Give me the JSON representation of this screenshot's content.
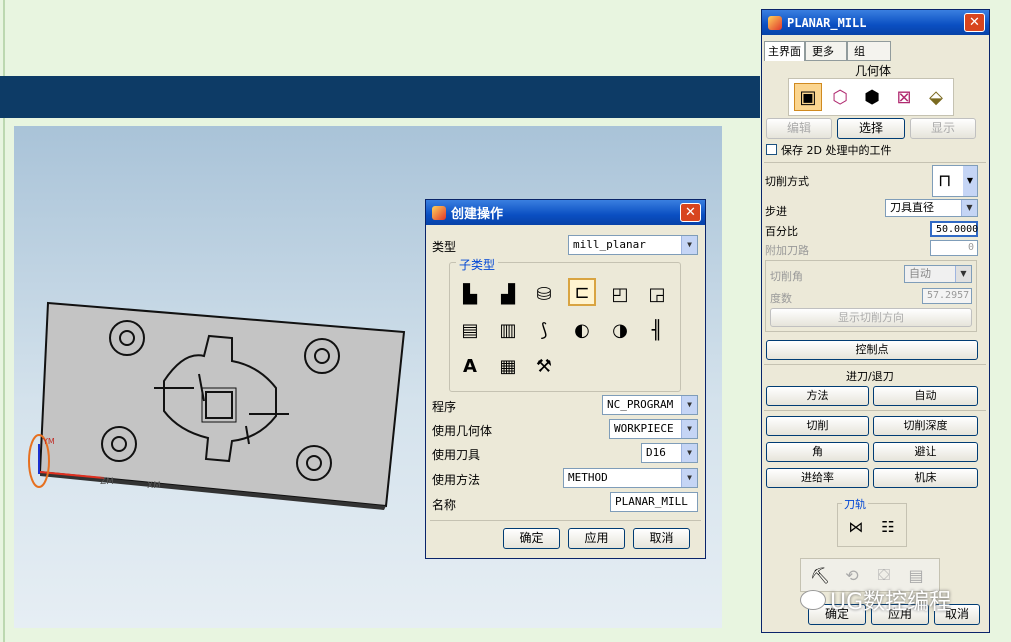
{
  "viewport": {
    "label_xm": "XM",
    "label_ym": "YM"
  },
  "create_op": {
    "title": "创建操作",
    "type_label": "类型",
    "type_value": "mill_planar",
    "subtype_label": "子类型",
    "program_label": "程序",
    "program_value": "NC_PROGRAM",
    "geometry_label": "使用几何体",
    "geometry_value": "WORKPIECE",
    "tool_label": "使用刀具",
    "tool_value": "D16",
    "method_label": "使用方法",
    "method_value": "METHOD",
    "name_label": "名称",
    "name_value": "PLANAR_MILL",
    "ok": "确定",
    "apply": "应用",
    "cancel": "取消"
  },
  "planar": {
    "title": "PLANAR_MILL",
    "tabs": [
      "主界面",
      "更多",
      "组"
    ],
    "geometry_label": "几何体",
    "edit": "编辑",
    "select": "选择",
    "display": "显示",
    "save2d": "保存 2D 处理中的工件",
    "cut_method_label": "切削方式",
    "step_label": "步进",
    "step_value": "刀具直径",
    "percent_label": "百分比",
    "percent_value": "50.0000",
    "extra_pass_label": "附加刀路",
    "extra_pass_value": "0",
    "cut_angle_label": "切削角",
    "cut_angle_value": "自动",
    "degree_label": "度数",
    "degree_value": "57.2957",
    "show_cut_dir": "显示切削方向",
    "control_points": "控制点",
    "engage_label": "进刀/退刀",
    "method": "方法",
    "auto": "自动",
    "cut": "切削",
    "cut_depth": "切削深度",
    "corner": "角",
    "avoid": "避让",
    "feed_rate": "进给率",
    "machine": "机床",
    "toolpath_label": "刀轨",
    "ok": "确定",
    "apply": "应用",
    "cancel": "取消"
  },
  "watermark": "UG数控编程"
}
